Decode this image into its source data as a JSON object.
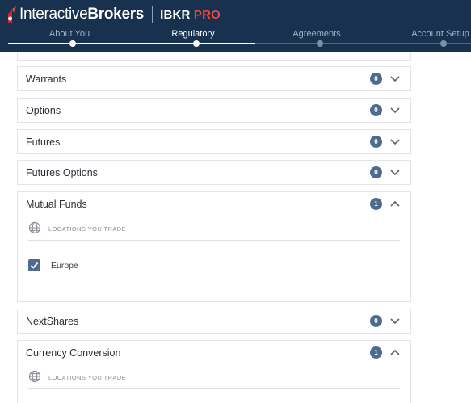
{
  "brand": {
    "name_light": "Interactive",
    "name_bold": "Brokers",
    "product": "IBKR",
    "product_accent": "PRO",
    "accent_color": "#e7473c"
  },
  "steps": [
    {
      "label": "About You",
      "state": "done"
    },
    {
      "label": "Regulatory",
      "state": "active"
    },
    {
      "label": "Agreements",
      "state": "pending"
    },
    {
      "label": "Account Setup",
      "state": "pending"
    }
  ],
  "sections": [
    {
      "title": "Warrants",
      "count": "0",
      "expanded": false
    },
    {
      "title": "Options",
      "count": "0",
      "expanded": false
    },
    {
      "title": "Futures",
      "count": "0",
      "expanded": false
    },
    {
      "title": "Futures Options",
      "count": "0",
      "expanded": false
    },
    {
      "title": "Mutual Funds",
      "count": "1",
      "expanded": true,
      "locations_label": "LOCATIONS YOU TRADE",
      "locations": [
        {
          "label": "Europe",
          "checked": true
        }
      ]
    },
    {
      "title": "NextShares",
      "count": "0",
      "expanded": false
    },
    {
      "title": "Currency Conversion",
      "count": "1",
      "expanded": true,
      "locations_label": "LOCATIONS YOU TRADE"
    }
  ],
  "colors": {
    "header_bg": "#18314f",
    "badge_bg": "#4f6a8f",
    "checkbox_bg": "#4f6a8f"
  }
}
